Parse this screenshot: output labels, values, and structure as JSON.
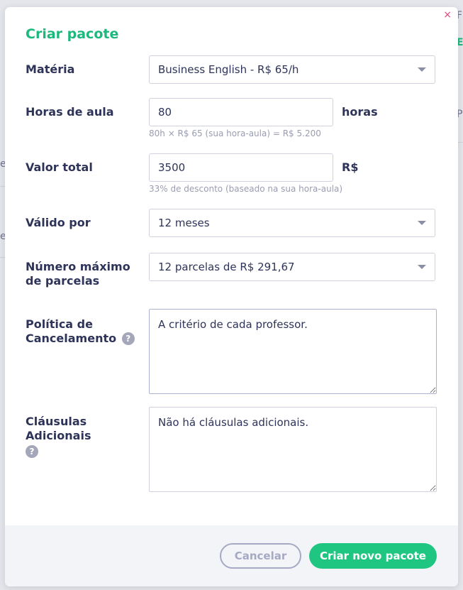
{
  "background": {
    "fragments": [
      "F",
      "E",
      "P",
      "e",
      "e"
    ]
  },
  "modal": {
    "close_glyph": "×",
    "title": "Criar pacote"
  },
  "fields": {
    "materia": {
      "label": "Matéria",
      "value": "Business English - R$ 65/h"
    },
    "horas": {
      "label": "Horas de aula",
      "value": "80",
      "unit": "horas",
      "hint": "80h × R$ 65 (sua hora-aula) = R$ 5.200"
    },
    "valor": {
      "label": "Valor total",
      "value": "3500",
      "unit": "R$",
      "hint": "33% de desconto (baseado na sua hora-aula)"
    },
    "validade": {
      "label": "Válido por",
      "value": "12 meses"
    },
    "parcelas": {
      "label": "Número máximo de parcelas",
      "value": "12 parcelas de R$ 291,67"
    },
    "cancelamento": {
      "label_line1": "Política de",
      "label_line2": "Cancelamento",
      "help_glyph": "?",
      "value": "A critério de cada professor."
    },
    "clausulas": {
      "label": "Cláusulas Adicionais",
      "help_glyph": "?",
      "value": "Não há cláusulas adicionais."
    }
  },
  "footer": {
    "cancel_label": "Cancelar",
    "create_label": "Criar novo pacote"
  },
  "colors": {
    "accent": "#1cb87c",
    "button_green": "#1fc682",
    "label_text": "#2e3459",
    "hint_text": "#9a9db0",
    "close": "#e0457b"
  }
}
